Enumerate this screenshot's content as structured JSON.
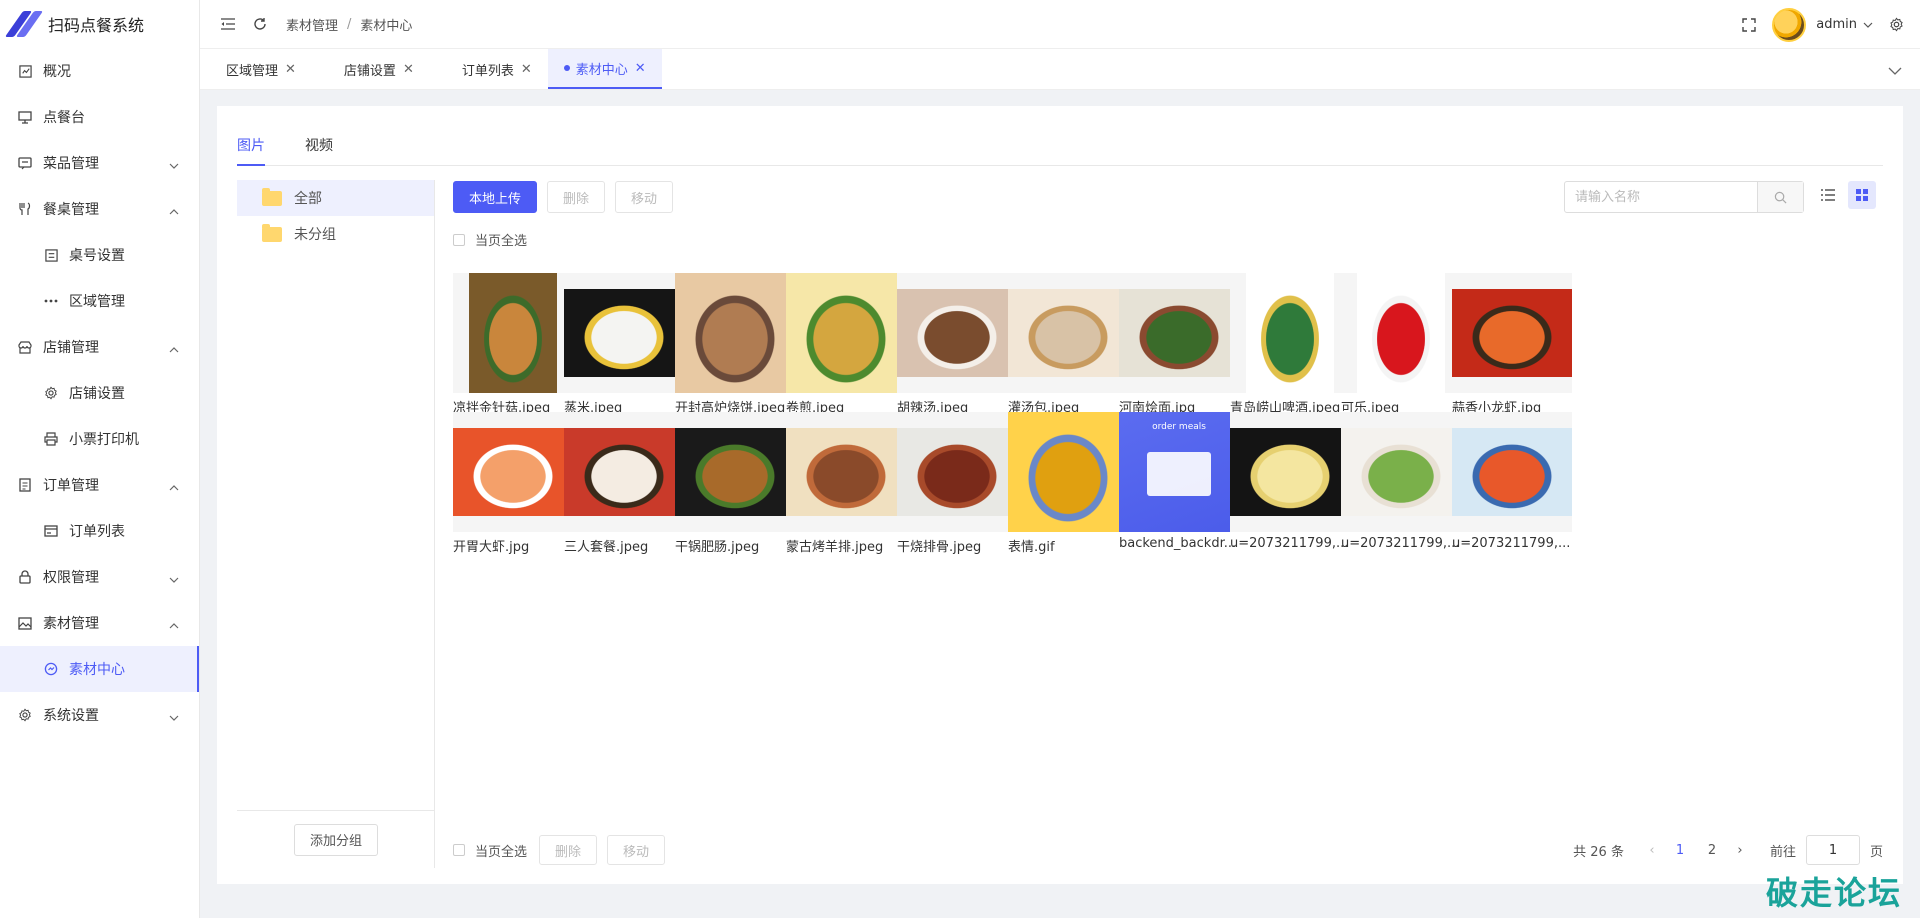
{
  "app": {
    "title": "扫码点餐系统",
    "brand_color": "#4d5bf5"
  },
  "sidebar": {
    "items": [
      {
        "label": "概况",
        "icon": "dashboard-icon",
        "level": 1,
        "expandable": false
      },
      {
        "label": "点餐台",
        "icon": "monitor-icon",
        "level": 1,
        "expandable": false
      },
      {
        "label": "菜品管理",
        "icon": "dish-icon",
        "level": 1,
        "expandable": true,
        "expanded": false
      },
      {
        "label": "餐桌管理",
        "icon": "fork-knife-icon",
        "level": 1,
        "expandable": true,
        "expanded": true
      },
      {
        "label": "桌号设置",
        "icon": "table-number-icon",
        "level": 2
      },
      {
        "label": "区域管理",
        "icon": "dots-icon",
        "level": 2
      },
      {
        "label": "店铺管理",
        "icon": "store-icon",
        "level": 1,
        "expandable": true,
        "expanded": true
      },
      {
        "label": "店铺设置",
        "icon": "gear-icon",
        "level": 2
      },
      {
        "label": "小票打印机",
        "icon": "printer-icon",
        "level": 2
      },
      {
        "label": "订单管理",
        "icon": "order-icon",
        "level": 1,
        "expandable": true,
        "expanded": true
      },
      {
        "label": "订单列表",
        "icon": "card-icon",
        "level": 2
      },
      {
        "label": "权限管理",
        "icon": "lock-icon",
        "level": 1,
        "expandable": true,
        "expanded": false
      },
      {
        "label": "素材管理",
        "icon": "image-icon",
        "level": 1,
        "expandable": true,
        "expanded": true
      },
      {
        "label": "素材中心",
        "icon": "clock-icon",
        "level": 2,
        "active": true
      },
      {
        "label": "系统设置",
        "icon": "gear-icon",
        "level": 1,
        "expandable": true,
        "expanded": false
      }
    ]
  },
  "header": {
    "breadcrumb": [
      "素材管理",
      "素材中心"
    ],
    "user": "admin"
  },
  "tabs": [
    {
      "label": "区域管理",
      "active": false
    },
    {
      "label": "店铺设置",
      "active": false
    },
    {
      "label": "订单列表",
      "active": false
    },
    {
      "label": "素材中心",
      "active": true
    }
  ],
  "media": {
    "type_tabs": [
      {
        "label": "图片",
        "active": true
      },
      {
        "label": "视频",
        "active": false
      }
    ],
    "groups": [
      {
        "label": "全部",
        "active": true
      },
      {
        "label": "未分组",
        "active": false
      }
    ],
    "add_group_label": "添加分组",
    "upload_label": "本地上传",
    "delete_label": "删除",
    "move_label": "移动",
    "select_all_label": "当页全选",
    "search_placeholder": "请输入名称",
    "items": [
      {
        "name": "凉拌金针菇.jpeg",
        "colors": [
          "#7a5a2a",
          "#c9863c",
          "#3d6b2a"
        ],
        "shape": "tall"
      },
      {
        "name": "蒸米.jpeg",
        "colors": [
          "#151515",
          "#f4f4f2",
          "#e9c23a"
        ],
        "shape": "wide"
      },
      {
        "name": "开封高炉烧饼.jpeg",
        "colors": [
          "#e8c9a3",
          "#b07c52",
          "#6a4a3a"
        ],
        "shape": "full"
      },
      {
        "name": "卷煎.jpeg",
        "colors": [
          "#f6e7a8",
          "#d4a63f",
          "#4d8a2e"
        ],
        "shape": "full"
      },
      {
        "name": "胡辣汤.jpeg",
        "colors": [
          "#d9c2b0",
          "#7a4c2e",
          "#f4efe9"
        ],
        "shape": "wide"
      },
      {
        "name": "灌汤包.jpeg",
        "colors": [
          "#f2e6d6",
          "#d8c2a6",
          "#c89b5f"
        ],
        "shape": "wide"
      },
      {
        "name": "河南烩面.jpg",
        "colors": [
          "#e6e2d6",
          "#3a6b2a",
          "#8a4a30"
        ],
        "shape": "wide"
      },
      {
        "name": "青岛崂山啤酒.jpeg",
        "colors": [
          "#ffffff",
          "#2f7a3a",
          "#e0c04a"
        ],
        "shape": "tall"
      },
      {
        "name": "可乐.jpeg",
        "colors": [
          "#ffffff",
          "#d8161d",
          "#f4f4f4"
        ],
        "shape": "tall"
      },
      {
        "name": "蒜香小龙虾.jpg",
        "colors": [
          "#c42a18",
          "#e86a2a",
          "#3a2a1a"
        ],
        "shape": "wide"
      },
      {
        "name": "开胃大虾.jpg",
        "colors": [
          "#e8542a",
          "#f4a06a",
          "#ffffff"
        ],
        "shape": "wide"
      },
      {
        "name": "三人套餐.jpeg",
        "colors": [
          "#c93a2a",
          "#f4ece2",
          "#3a2a1a"
        ],
        "shape": "wide"
      },
      {
        "name": "干锅肥肠.jpeg",
        "colors": [
          "#1a1a1a",
          "#a86a2a",
          "#4a7a2a"
        ],
        "shape": "wide"
      },
      {
        "name": "蒙古烤羊排.jpeg",
        "colors": [
          "#f0e0c0",
          "#8a4a2a",
          "#c06a3a"
        ],
        "shape": "wide"
      },
      {
        "name": "干烧排骨.jpeg",
        "colors": [
          "#e8e8e4",
          "#7a2a1a",
          "#a84a2a"
        ],
        "shape": "wide"
      },
      {
        "name": "表情.gif",
        "colors": [
          "#ffd24a",
          "#e0a010",
          "#6a88c8"
        ],
        "shape": "full"
      },
      {
        "name": "backend_backdr...",
        "colors": [
          "#5b6cf0",
          "#4b5cea",
          "#ffffff"
        ],
        "shape": "full",
        "overlay": "order meals"
      },
      {
        "name": "u=2073211799,...",
        "colors": [
          "#141414",
          "#f4e6a0",
          "#e6d070"
        ],
        "shape": "wide"
      },
      {
        "name": "u=2073211799,...",
        "colors": [
          "#f4f2ee",
          "#7ab04a",
          "#e8e0d4"
        ],
        "shape": "wide"
      },
      {
        "name": "u=2073211799,...",
        "colors": [
          "#d6e8f4",
          "#e8582a",
          "#3a6ab0"
        ],
        "shape": "wide"
      }
    ]
  },
  "pagination": {
    "total_label": "共 26 条",
    "pages": [
      "1",
      "2"
    ],
    "current": "1",
    "goto_label": "前往",
    "goto_value": "1",
    "page_suffix": "页"
  },
  "watermark": "破走论坛"
}
